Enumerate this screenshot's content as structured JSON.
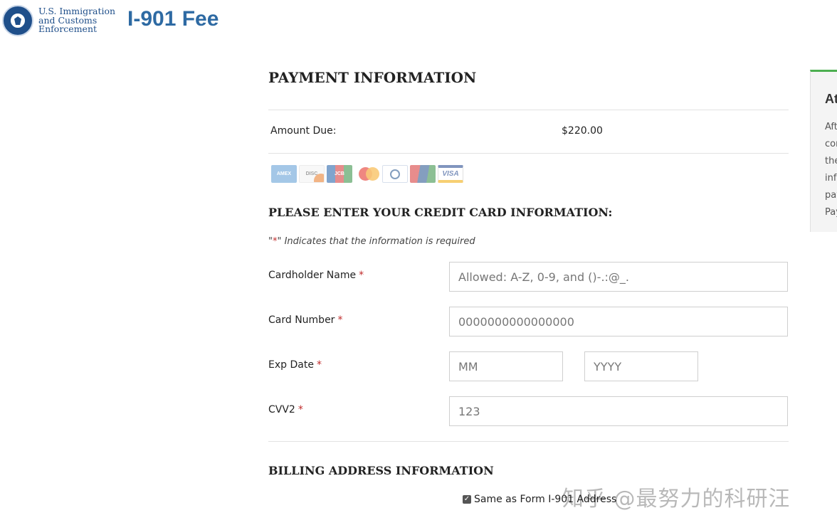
{
  "header": {
    "agency_lines": [
      "U.S. Immigration",
      "and Customs",
      "Enforcement"
    ],
    "app_title": "I-901 Fee"
  },
  "payment": {
    "title": "PAYMENT INFORMATION",
    "amount_label": "Amount Due:",
    "amount_value": "$220.00",
    "card_brands": [
      "American Express",
      "Discover",
      "JCB",
      "MasterCard",
      "Diners Club",
      "UnionPay",
      "Visa"
    ]
  },
  "card_form": {
    "title": "PLEASE ENTER YOUR CREDIT CARD INFORMATION:",
    "required_note_prefix": "\"",
    "required_note_star": "*",
    "required_note_suffix": "\" Indicates that the information is required",
    "required_mark": "*",
    "cardholder_label": "Cardholder Name",
    "cardholder_placeholder": "Allowed: A-Z, 0-9, and ()-.:@_.",
    "card_number_label": "Card Number",
    "card_number_placeholder": "0000000000000000",
    "exp_label": "Exp Date",
    "exp_month_placeholder": "MM",
    "exp_year_placeholder": "YYYY",
    "cvv_label": "CVV2",
    "cvv_placeholder": "123"
  },
  "billing": {
    "title": "BILLING ADDRESS INFORMATION",
    "same_as_label": "Same as Form I-901 Address",
    "same_as_checked": true
  },
  "sidebar": {
    "title": "At",
    "lines": [
      "Aft",
      "cor",
      "the",
      "inf",
      "pay",
      "Pay"
    ]
  },
  "watermark": "知乎 @最努力的科研汪",
  "colors": {
    "title_blue": "#2e6aa3",
    "required_red": "#c02b2b",
    "sidebar_accent": "#4caf50"
  }
}
